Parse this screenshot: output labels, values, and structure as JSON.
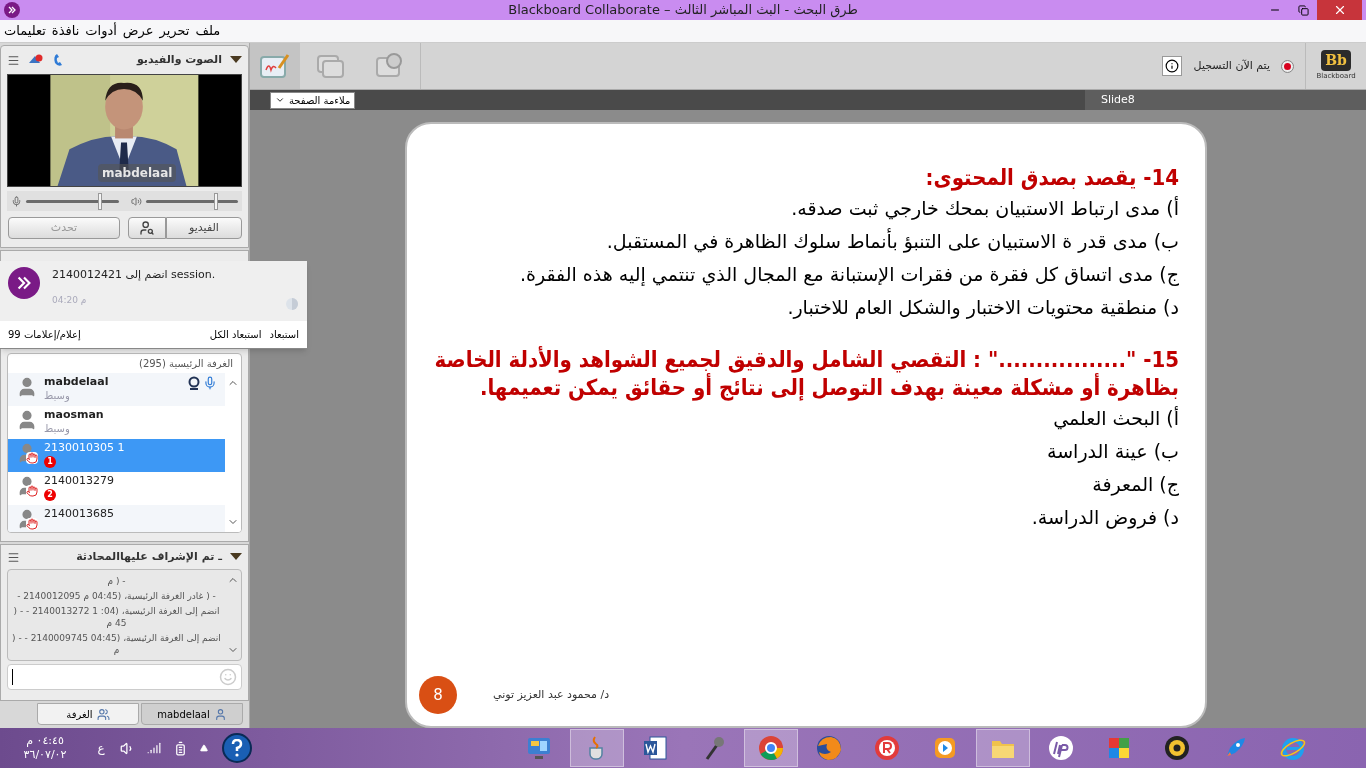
{
  "window": {
    "title": "Blackboard Collaborate – طرق البحث - البث المباشر الثالث"
  },
  "menu": [
    "ملف",
    "تحرير",
    "عرض",
    "أدوات",
    "نافذة",
    "تعليمات"
  ],
  "audio_video": {
    "title": "الصوت والفيديو",
    "video_label": "mabdelaal",
    "mic": {
      "level": 0.8
    },
    "speaker": {
      "level": 0.76
    },
    "buttons": [
      {
        "label": "الفيديو",
        "disabled": false
      },
      {
        "label": "تحدث",
        "disabled": true
      }
    ]
  },
  "notification": {
    "message": "2140012421 انضم إلى session.",
    "time": "04:20 م",
    "count": "99 إعلام/إعلامات",
    "actions": [
      "استبعاد",
      "استبعاد الكل"
    ]
  },
  "participants": {
    "room": "الغرفة الرئيسية (295)",
    "items": [
      {
        "name": "mabdelaal",
        "kind": "moderator",
        "role": "وسيط",
        "talking": true,
        "selected": false
      },
      {
        "name": "maosman",
        "kind": "moderator",
        "role": "وسيط",
        "talking": false,
        "selected": false
      },
      {
        "name": "2130010305 1",
        "kind": "hand",
        "badge": "1",
        "selected": true
      },
      {
        "name": "2140013279",
        "kind": "hand",
        "badge": "2",
        "selected": false
      },
      {
        "name": "2140013685",
        "kind": "hand",
        "selected": false
      }
    ]
  },
  "chat": {
    "title": "ـ تم الإشراف عليهاالمحادثة",
    "messages": [
      "- ( م",
      "- ( غادر الغرفة الرئيسية، (04:45 م 2140012095 -",
      "انضم إلى الغرفة الرئيسية، (04: 1 2140013272 - - ( 45 م",
      "انضم إلى الغرفة الرئيسية، (04:45 2140009745 - - ( م"
    ],
    "tabs": [
      {
        "label": "mabdelaal",
        "selected": false
      },
      {
        "label": "الغرفة",
        "selected": true
      }
    ]
  },
  "toolbar": {
    "recording": true,
    "recording_label": "يتم الآن التسجيل",
    "logo": {
      "mark": "Bb",
      "name": "Blackboard"
    },
    "view": "ملاءمة الصفحة",
    "tab": "Slide8"
  },
  "slide": {
    "blocks": [
      {
        "kind": "heading",
        "text": "14- يقصد بصدق المحتوى:"
      },
      {
        "kind": "option",
        "text": "أ) مدى ارتباط الاستبيان بمحك خارجي ثبت صدقه."
      },
      {
        "kind": "option",
        "text": "ب) مدى قدر ة الاستبيان على التنبؤ بأنماط سلوك الظاهرة في المستقبل."
      },
      {
        "kind": "option",
        "text": "ج) مدى اتساق كل فقرة من فقرات الإستبانة مع المجال الذي تنتمي إليه هذه الفقرة."
      },
      {
        "kind": "option",
        "text": "د) منطقية محتويات الاختبار والشكل العام للاختبار."
      },
      {
        "kind": "gap"
      },
      {
        "kind": "heading",
        "text": "15- \".................\" :  التقصي الشامل والدقيق لجميع الشواهد والأدلة الخاصة بظاهرة أو مشكلة معينة بهدف التوصل إلى نتائج أو حقائق يمكن تعميمها."
      },
      {
        "kind": "option",
        "text": "أ) البحث العلمي"
      },
      {
        "kind": "option",
        "text": "ب)  عينة الدراسة"
      },
      {
        "kind": "option",
        "text": "ج) المعرفة"
      },
      {
        "kind": "option",
        "text": "د) فروض الدراسة."
      }
    ],
    "footer": "د/ محمود عبد العزيز توني",
    "page": "8"
  },
  "taskbar": {
    "time": "٠٤:٤٥ م",
    "date": "٣٦/٠٧/٠٢",
    "language": "ع",
    "apps": [
      {
        "kind": "monitor",
        "selected": false
      },
      {
        "kind": "cup",
        "selected": true
      },
      {
        "kind": "word",
        "selected": false
      },
      {
        "kind": "mic",
        "selected": false
      },
      {
        "kind": "chrome",
        "selected": true
      },
      {
        "kind": "fox",
        "selected": false
      },
      {
        "kind": "r",
        "selected": false
      },
      {
        "kind": "play",
        "selected": false
      },
      {
        "kind": "folder",
        "selected": true
      },
      {
        "kind": "hp",
        "selected": false
      },
      {
        "kind": "puzzle",
        "selected": false
      },
      {
        "kind": "webcam",
        "selected": false
      },
      {
        "kind": "rocket",
        "selected": false
      },
      {
        "kind": "ie",
        "selected": false
      }
    ]
  }
}
